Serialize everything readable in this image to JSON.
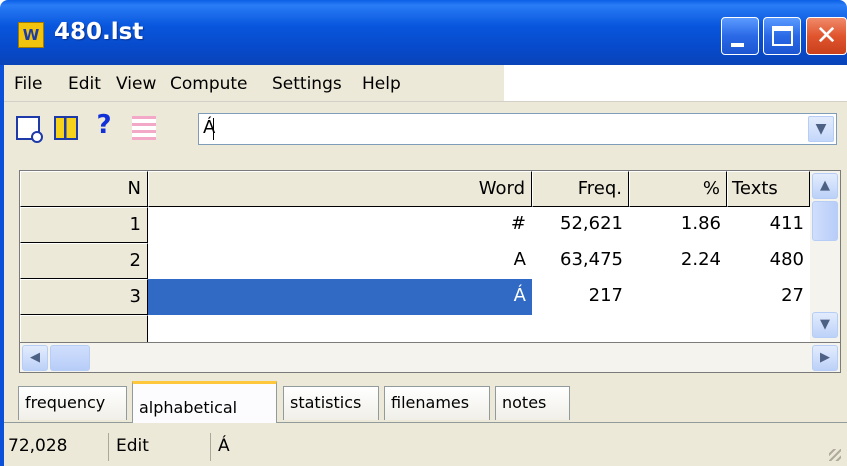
{
  "window": {
    "title": "480.lst",
    "app_icon_label": "W"
  },
  "menu": {
    "items": [
      "File",
      "Edit",
      "View",
      "Compute",
      "Settings",
      "Help"
    ]
  },
  "toolbar": {
    "icons": [
      "preview-icon",
      "columns-icon",
      "help-icon",
      "lines-icon"
    ],
    "help_glyph": "?",
    "search_value": "Á",
    "dropdown_glyph": "▼"
  },
  "table": {
    "columns": [
      "N",
      "Word",
      "Freq.",
      "%",
      "Texts"
    ],
    "rows": [
      {
        "n": "1",
        "word": "#",
        "freq": "52,621",
        "pct": "1.86",
        "texts": "411"
      },
      {
        "n": "2",
        "word": "A",
        "freq": "63,475",
        "pct": "2.24",
        "texts": "480"
      },
      {
        "n": "3",
        "word": "Á",
        "freq": "217",
        "pct": "",
        "texts": "27"
      }
    ],
    "selected_row": 3
  },
  "tabs": {
    "items": [
      "frequency",
      "alphabetical",
      "statistics",
      "filenames",
      "notes"
    ],
    "active": "alphabetical"
  },
  "status": {
    "count": "72,028",
    "mode": "Edit",
    "word": "Á"
  },
  "colors": {
    "selection": "#316ac5",
    "titlebar": "#0856dd",
    "active_tab_accent": "#ffc83c"
  }
}
